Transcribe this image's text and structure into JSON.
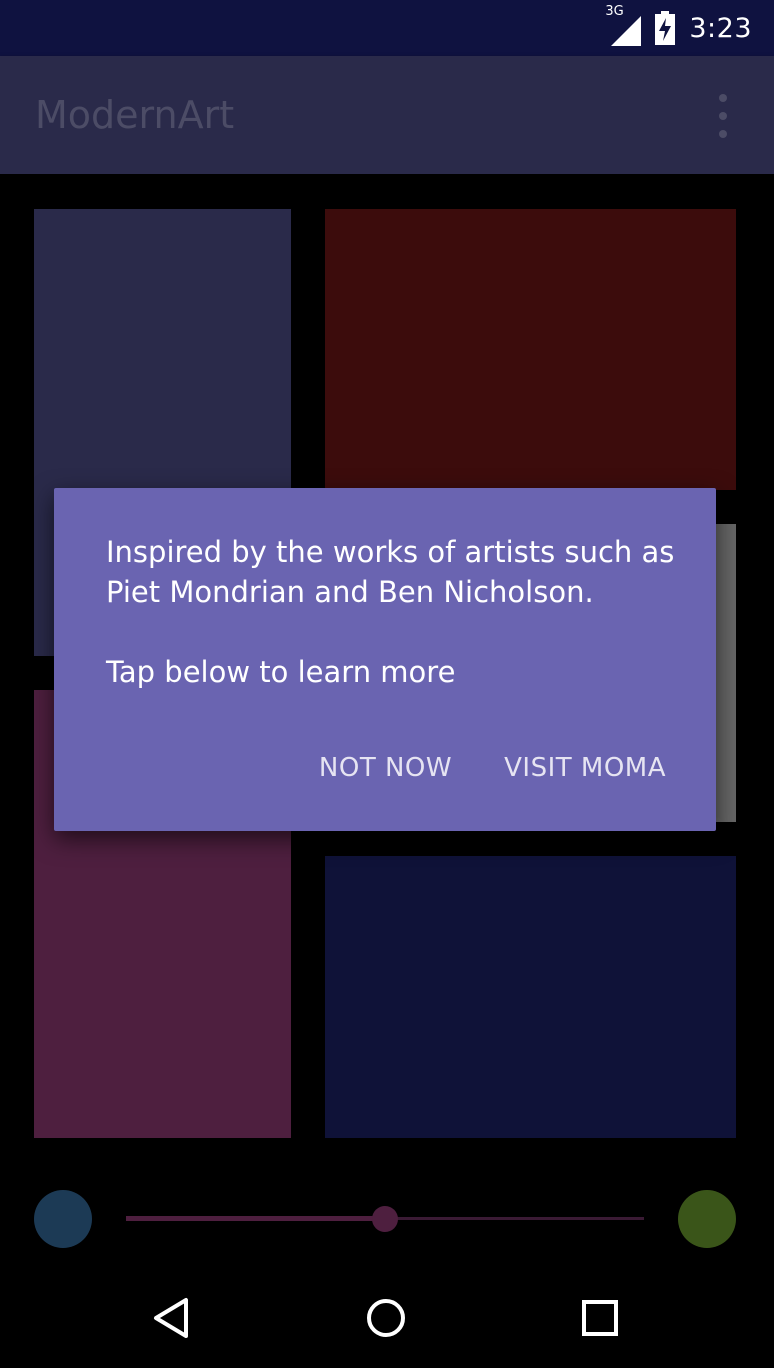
{
  "status_bar": {
    "network_label": "3G",
    "time": "3:23",
    "signal_icon": "signal-icon",
    "battery_icon": "battery-charging-icon"
  },
  "app_bar": {
    "title": "ModernArt",
    "menu_icon": "overflow-menu-icon"
  },
  "art_blocks": [
    {
      "name": "art-block-top-left",
      "color": "#2a2a4a"
    },
    {
      "name": "art-block-top-right",
      "color": "#3c0c0c"
    },
    {
      "name": "art-block-middle-right",
      "color": "#666666"
    },
    {
      "name": "art-block-bottom-left",
      "color": "#4e1f3f"
    },
    {
      "name": "art-block-bottom-right",
      "color": "#0f1238"
    }
  ],
  "slider": {
    "value_fraction": 0.5,
    "left_color": "#1c3a55",
    "right_color": "#3a5519",
    "track_color": "#4e1f3f"
  },
  "dialog": {
    "message_line1": "Inspired by the works of artists such as Piet Mondrian and Ben Nicholson.",
    "message_line2": "Tap below to learn more",
    "negative_button": "NOT NOW",
    "positive_button": "VISIT MOMA",
    "background_color": "#6a64b1"
  },
  "nav_bar": {
    "back_icon": "back-triangle-icon",
    "home_icon": "home-circle-icon",
    "recents_icon": "recents-square-icon"
  }
}
